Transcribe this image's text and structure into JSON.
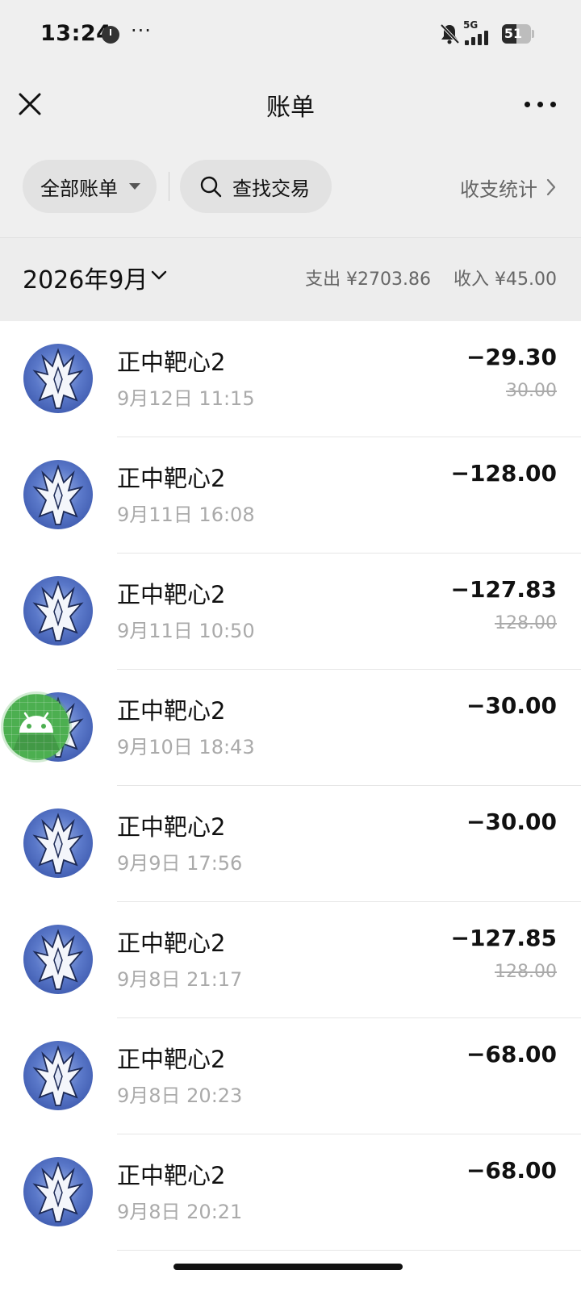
{
  "status_bar": {
    "time": "13:24",
    "network": "5G",
    "battery": "51",
    "battery_level": 0.51
  },
  "nav": {
    "title": "账单"
  },
  "filters": {
    "all_bills_label": "全部账单",
    "search_label": "查找交易",
    "stats_label": "收支统计"
  },
  "month_bar": {
    "month": "2026年9月",
    "expense": "支出 ¥2703.86",
    "income": "收入 ¥45.00"
  },
  "transactions": [
    {
      "name": "正中靶心2",
      "date": "9月12日 11:15",
      "amount": "−29.30",
      "original": "30.00"
    },
    {
      "name": "正中靶心2",
      "date": "9月11日 16:08",
      "amount": "−128.00",
      "original": ""
    },
    {
      "name": "正中靶心2",
      "date": "9月11日 10:50",
      "amount": "−127.83",
      "original": "128.00"
    },
    {
      "name": "正中靶心2",
      "date": "9月10日 18:43",
      "amount": "−30.00",
      "original": ""
    },
    {
      "name": "正中靶心2",
      "date": "9月9日 17:56",
      "amount": "−30.00",
      "original": ""
    },
    {
      "name": "正中靶心2",
      "date": "9月8日 21:17",
      "amount": "−127.85",
      "original": "128.00"
    },
    {
      "name": "正中靶心2",
      "date": "9月8日 20:23",
      "amount": "−68.00",
      "original": ""
    },
    {
      "name": "正中靶心2",
      "date": "9月8日 20:21",
      "amount": "−68.00",
      "original": ""
    }
  ],
  "colors": {
    "header_bg": "#efefef",
    "pill_bg": "#e2e2e2",
    "muted_text": "#aaaaaa",
    "avatar_blue": "#3f5db5",
    "float_green": "#4caf50"
  }
}
